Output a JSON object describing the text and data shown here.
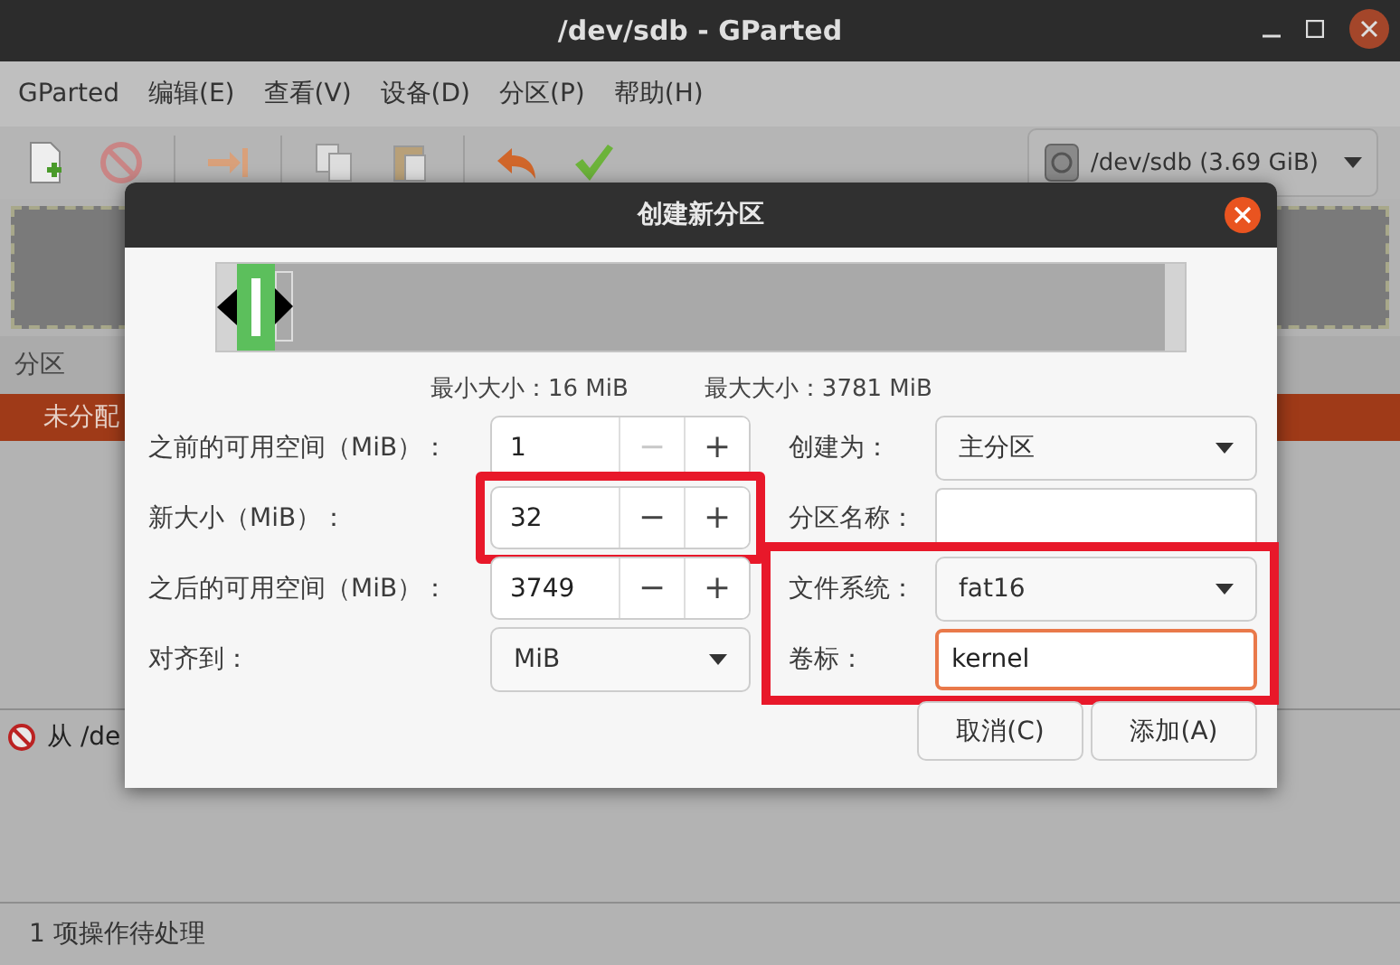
{
  "window": {
    "title": "/dev/sdb - GParted"
  },
  "menu": [
    "GParted",
    "编辑(E)",
    "查看(V)",
    "设备(D)",
    "分区(P)",
    "帮助(H)"
  ],
  "toolbar": [
    {
      "kind": "new"
    },
    {
      "kind": "delete"
    },
    {
      "kind": "sep"
    },
    {
      "kind": "resize"
    },
    {
      "kind": "sep"
    },
    {
      "kind": "copy"
    },
    {
      "kind": "paste"
    },
    {
      "kind": "sep"
    },
    {
      "kind": "undo"
    },
    {
      "kind": "apply"
    }
  ],
  "device": {
    "label": "/dev/sdb (3.69 GiB)"
  },
  "partition_table": {
    "columns": [
      "分区"
    ],
    "rows": [
      {
        "cells": [
          "未分配"
        ],
        "selected": true
      }
    ]
  },
  "pending": [
    "从 /de"
  ],
  "status_bar": "1 项操作待处理",
  "dialog": {
    "title": "创建新分区",
    "resizer": {
      "level": 0.04
    },
    "min_size": "最小大小：16 MiB",
    "max_size": "最大大小：3781 MiB",
    "left_rows": [
      {
        "kind": "spin",
        "label": "之前的可用空间（MiB）：",
        "value": "1",
        "minus_disabled": true,
        "highlighted": false,
        "minus": "−",
        "plus": "+"
      },
      {
        "kind": "spin",
        "label": "新大小（MiB）：",
        "value": "32",
        "minus_disabled": false,
        "highlighted": true,
        "minus": "−",
        "plus": "+"
      },
      {
        "kind": "spin",
        "label": "之后的可用空间（MiB）：",
        "value": "3749",
        "minus_disabled": false,
        "highlighted": false,
        "minus": "−",
        "plus": "+"
      },
      {
        "kind": "combo",
        "label": "对齐到：",
        "value": "MiB",
        "highlighted": false
      }
    ],
    "right_groups": [
      {
        "highlighted": false,
        "rows": [
          {
            "kind": "combo",
            "label": "创建为：",
            "value": "主分区"
          },
          {
            "kind": "entry",
            "label": "分区名称：",
            "value": "",
            "focused": false
          }
        ]
      },
      {
        "highlighted": true,
        "rows": [
          {
            "kind": "combo",
            "label": "文件系统：",
            "value": "fat16"
          },
          {
            "kind": "entry",
            "label": "卷标：",
            "value": "kernel",
            "focused": true
          }
        ]
      }
    ],
    "buttons": [
      "取消(C)",
      "添加(A)"
    ]
  }
}
